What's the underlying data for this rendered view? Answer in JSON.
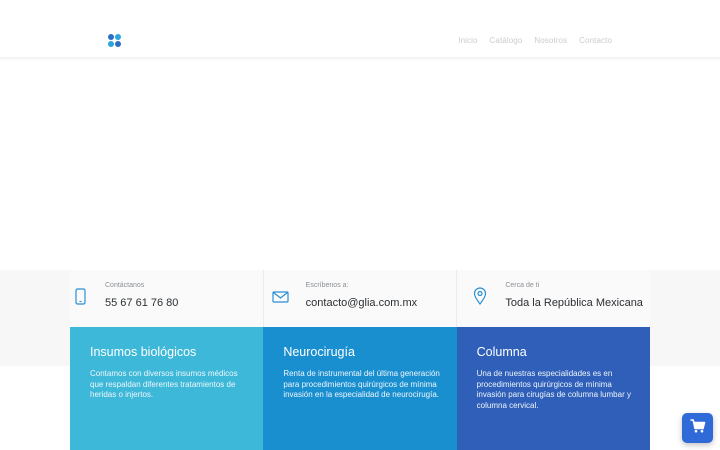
{
  "nav": {
    "items": [
      "Inicio",
      "Catálogo",
      "Nosotros",
      "Contacto"
    ]
  },
  "contact": [
    {
      "icon": "phone-icon",
      "label": "Contáctanos",
      "value": "55 67 61 76 80"
    },
    {
      "icon": "mail-icon",
      "label": "Escríbenos a:",
      "value": "contacto@glia.com.mx"
    },
    {
      "icon": "location-pin-icon",
      "label": "Cerca de ti",
      "value": "Toda la  República Mexicana"
    }
  ],
  "cards": [
    {
      "title": "Insumos biológicos",
      "text": "Contamos con diversos insumos médicos que respaldan diferentes tratamientos de heridas o injertos.",
      "color": "#3db8d9"
    },
    {
      "title": "Neurocirugía",
      "text": "Renta de instrumental del última generación para procedimientos quirúrgicos de mínima invasión en la especialidad de neurocirugía.",
      "color": "#1a8fd0"
    },
    {
      "title": "Columna",
      "text": "Una de nuestras especialidades es en procedimientos quirúrgicos de mínima invasión para cirugías de columna lumbar y columna cervical.",
      "color": "#2f5fb8"
    }
  ],
  "colors": {
    "accent": "#1e8fd0",
    "cart_button": "#2f6ad8",
    "icon": "#2a8fd4"
  },
  "cart": {
    "icon": "shopping-cart-icon"
  }
}
